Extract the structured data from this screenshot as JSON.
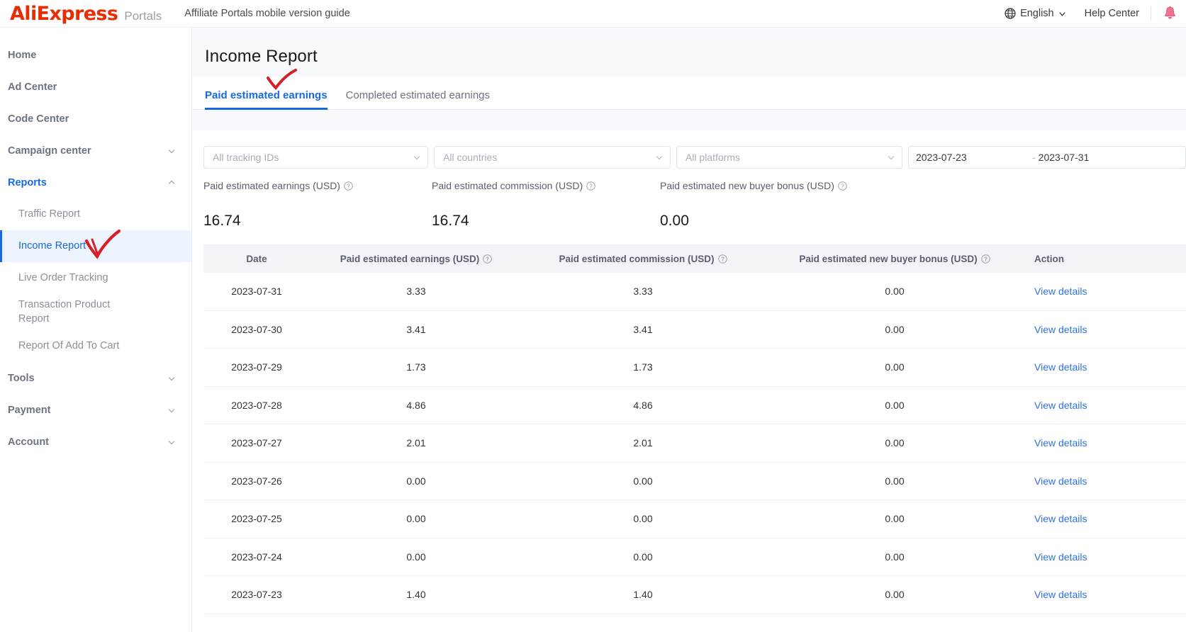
{
  "header": {
    "logo_text": "AliExpress",
    "logo_color": "#e62e04",
    "portals_label": "Portals",
    "guide_link": "Affiliate Portals mobile version guide",
    "language": "English",
    "help_center": "Help Center",
    "globe_icon": "globe-icon",
    "bell_icon": "bell-icon",
    "chevron_icon": "chevron-down-icon"
  },
  "sidebar": {
    "items": [
      {
        "label": "Home",
        "type": "top",
        "active": false,
        "caret": ""
      },
      {
        "label": "Ad Center",
        "type": "top",
        "active": false,
        "caret": ""
      },
      {
        "label": "Code Center",
        "type": "top",
        "active": false,
        "caret": ""
      },
      {
        "label": "Campaign center",
        "type": "top",
        "active": false,
        "caret": "down"
      },
      {
        "label": "Reports",
        "type": "top",
        "active": true,
        "caret": "up"
      },
      {
        "label": "Traffic Report",
        "type": "sub",
        "selected": false
      },
      {
        "label": "Income Report",
        "type": "sub",
        "selected": true
      },
      {
        "label": "Live Order Tracking",
        "type": "sub",
        "selected": false
      },
      {
        "label": "Transaction Product Report",
        "type": "sub",
        "selected": false
      },
      {
        "label": "Report Of Add To Cart",
        "type": "sub",
        "selected": false
      },
      {
        "label": "Tools",
        "type": "top",
        "active": false,
        "caret": "down"
      },
      {
        "label": "Payment",
        "type": "top",
        "active": false,
        "caret": "down"
      },
      {
        "label": "Account",
        "type": "top",
        "active": false,
        "caret": "down"
      }
    ],
    "active_color": "#1769e0",
    "selected_bg": "#eef4fd"
  },
  "main": {
    "page_title": "Income Report",
    "tabs": [
      {
        "label": "Paid estimated earnings",
        "active": true
      },
      {
        "label": "Completed estimated earnings",
        "active": false
      }
    ],
    "filters": {
      "tracking_ids": "All tracking IDs",
      "countries": "All countries",
      "platforms": "All platforms",
      "date_start": "2023-07-23",
      "date_separator": "-",
      "date_end": "2023-07-31"
    },
    "stats": [
      {
        "label": "Paid estimated earnings (USD)",
        "value": "16.74",
        "help": "help-icon"
      },
      {
        "label": "Paid estimated commission (USD)",
        "value": "16.74",
        "help": "help-icon"
      },
      {
        "label": "Paid estimated new buyer bonus (USD)",
        "value": "0.00",
        "help": "help-icon"
      }
    ],
    "table": {
      "columns": [
        {
          "label": "Date",
          "help": false
        },
        {
          "label": "Paid estimated earnings (USD)",
          "help": true
        },
        {
          "label": "Paid estimated commission (USD)",
          "help": true
        },
        {
          "label": "Paid estimated new buyer bonus (USD)",
          "help": true
        },
        {
          "label": "Action",
          "help": false
        }
      ],
      "action_label": "View details",
      "rows": [
        {
          "date": "2023-07-31",
          "earnings": "3.33",
          "commission": "3.33",
          "bonus": "0.00"
        },
        {
          "date": "2023-07-30",
          "earnings": "3.41",
          "commission": "3.41",
          "bonus": "0.00"
        },
        {
          "date": "2023-07-29",
          "earnings": "1.73",
          "commission": "1.73",
          "bonus": "0.00"
        },
        {
          "date": "2023-07-28",
          "earnings": "4.86",
          "commission": "4.86",
          "bonus": "0.00"
        },
        {
          "date": "2023-07-27",
          "earnings": "2.01",
          "commission": "2.01",
          "bonus": "0.00"
        },
        {
          "date": "2023-07-26",
          "earnings": "0.00",
          "commission": "0.00",
          "bonus": "0.00"
        },
        {
          "date": "2023-07-25",
          "earnings": "0.00",
          "commission": "0.00",
          "bonus": "0.00"
        },
        {
          "date": "2023-07-24",
          "earnings": "0.00",
          "commission": "0.00",
          "bonus": "0.00"
        },
        {
          "date": "2023-07-23",
          "earnings": "1.40",
          "commission": "1.40",
          "bonus": "0.00"
        }
      ]
    }
  },
  "annotations": {
    "color": "#d81e26",
    "marks": [
      {
        "name": "checkmark-income-report"
      },
      {
        "name": "checkmark-paid-tab"
      }
    ]
  }
}
